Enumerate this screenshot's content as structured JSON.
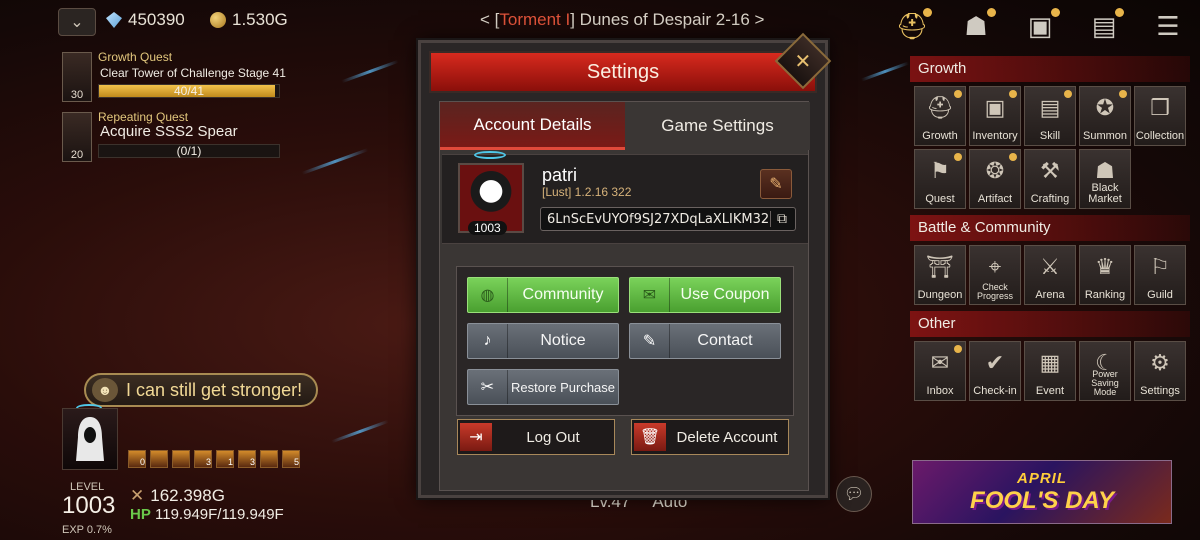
{
  "topbar": {
    "gems": "450390",
    "gold": "1.530G",
    "stage_prefix": "< [",
    "stage_difficulty": "Torment I",
    "stage_name": "] Dunes of Despair 2-16 >"
  },
  "quests": [
    {
      "type": "Growth Quest",
      "desc": "Clear Tower of Challenge Stage 41",
      "progress": "40/41",
      "fill": 0.976,
      "level": "30"
    },
    {
      "type": "Repeating Quest",
      "desc": "Acquire SSS2 Spear",
      "progress": "(0/1)",
      "fill": 0.0,
      "level": "20"
    }
  ],
  "speech": {
    "text": "I can still get stronger!"
  },
  "character": {
    "level_label": "LEVEL",
    "level": "1003",
    "exp": "EXP 0.7%",
    "power": "162.398G",
    "hp_label": "HP",
    "hp": "119.949F/119.949F",
    "skill_counts": [
      "0",
      "",
      "",
      "3",
      "1",
      "3",
      "",
      "5"
    ]
  },
  "bottom": {
    "lv": "Lv.47",
    "auto": "Auto"
  },
  "dialog": {
    "title": "Settings",
    "tab_account": "Account Details",
    "tab_game": "Game Settings",
    "profile": {
      "name": "patri",
      "info": "[Lust] 1.2.16 322",
      "level": "1003",
      "uid": "6LnScEvUYOf9SJ27XDqLaXLIKM32"
    },
    "buttons": {
      "community": "Community",
      "coupon": "Use Coupon",
      "notice": "Notice",
      "contact": "Contact",
      "restore": "Restore Purchase"
    },
    "logout": "Log Out",
    "delete": "Delete Account"
  },
  "right_panel": {
    "growth_title": "Growth",
    "growth": [
      "Growth",
      "Inventory",
      "Skill",
      "Summon",
      "Collection",
      "Quest",
      "Artifact",
      "Crafting",
      "Black Market"
    ],
    "battle_title": "Battle & Community",
    "battle": [
      "Dungeon",
      "Check Progress",
      "Arena",
      "Ranking",
      "Guild"
    ],
    "other_title": "Other",
    "other": [
      "Inbox",
      "Check-in",
      "Event",
      "Power Saving Mode",
      "Settings"
    ]
  },
  "event_banner": {
    "line1": "APRIL",
    "line2": "FOOL'S DAY"
  },
  "colors": {
    "accent_red": "#d82a1e",
    "green_button": "#5ab83a",
    "gold_text": "#e2c77d"
  }
}
